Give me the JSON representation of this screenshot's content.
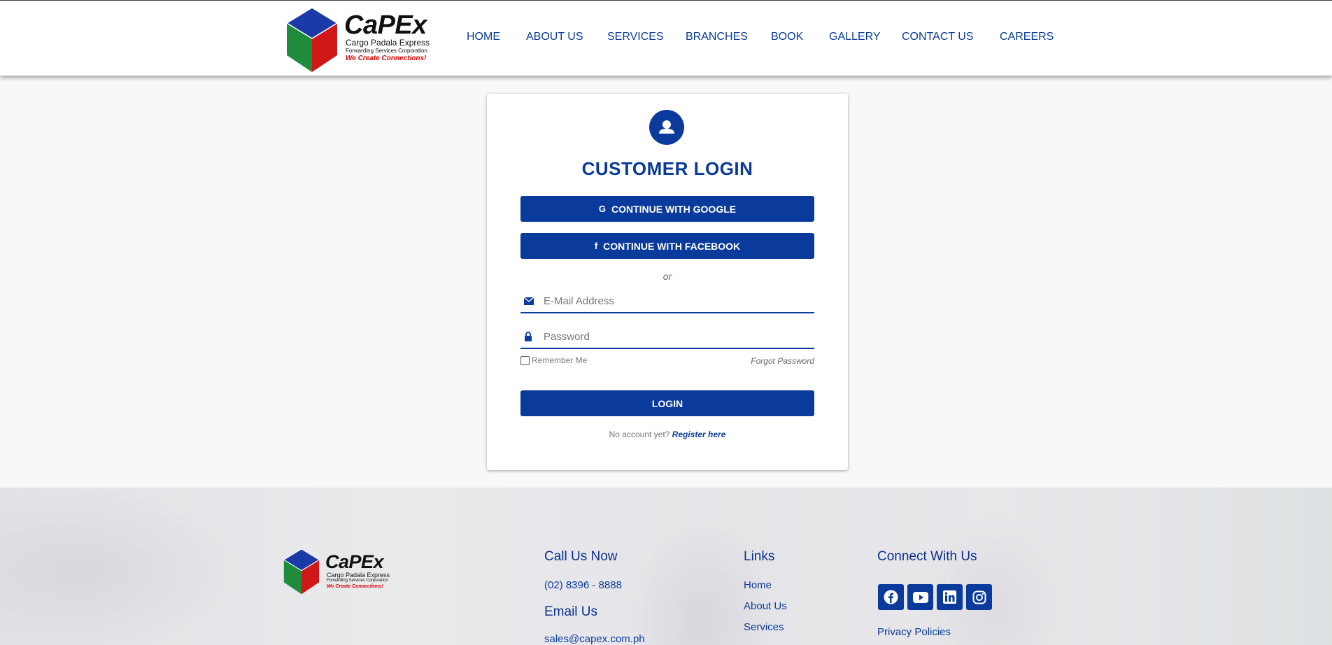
{
  "header": {
    "logo": {
      "name": "CaPEx",
      "subtitle": "Cargo Padala Express",
      "subtitle2": "Forwarding Services Corporation",
      "tagline": "We Create Connections!"
    },
    "nav": [
      "HOME",
      "ABOUT US",
      "SERVICES",
      "BRANCHES",
      "BOOK",
      "GALLERY",
      "CONTACT US",
      "CAREERS"
    ]
  },
  "login": {
    "title": "CUSTOMER LOGIN",
    "google_label": "CONTINUE WITH GOOGLE",
    "facebook_label": "CONTINUE WITH FACEBOOK",
    "or_text": "or",
    "email_placeholder": "E-Mail Address",
    "password_placeholder": "Password",
    "remember_label": "Remember Me",
    "forgot_label": "Forgot Password",
    "login_label": "LOGIN",
    "no_account_text": "No account yet?",
    "register_label": "Register here"
  },
  "footer": {
    "call_heading": "Call Us Now",
    "phone": "(02) 8396 - 8888",
    "email_heading": "Email Us",
    "email": "sales@capex.com.ph",
    "links_heading": "Links",
    "links": [
      "Home",
      "About Us",
      "Services"
    ],
    "connect_heading": "Connect With Us",
    "social": [
      "facebook-icon",
      "youtube-icon",
      "linkedin-icon",
      "instagram-icon"
    ],
    "privacy_label": "Privacy Policies"
  },
  "colors": {
    "primary": "#0a3a9c",
    "accent_red": "#dd0000",
    "cube_blue": "#1a3aa8",
    "cube_green": "#1e8c3a",
    "cube_red": "#d01818"
  }
}
